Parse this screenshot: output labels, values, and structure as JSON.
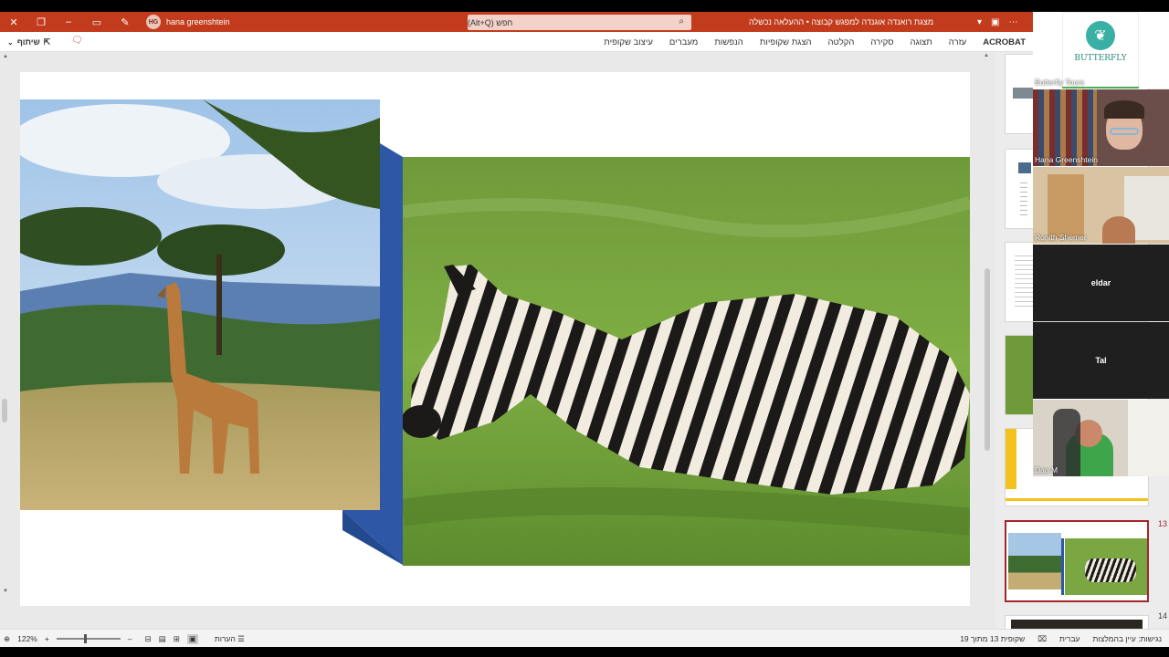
{
  "titlebar": {
    "user_name": "hana greenshtein",
    "user_initials": "HG",
    "search_placeholder": "חפש (Alt+Q)",
    "doc_title": "מצגת רואנדה אוגנדה למפגש קבוצה • ההעלאה נכשלה"
  },
  "ribbon": {
    "tabs": [
      "עיצוב שקופית",
      "מעברים",
      "הנפשות",
      "הצגת שקופיות",
      "הקלטה",
      "סקירה",
      "תצוגה",
      "עזרה",
      "ACROBAT"
    ],
    "share_label": "שיתוף"
  },
  "thumbnails": {
    "current_number": "13",
    "next_number": "14"
  },
  "participants": [
    {
      "name": "Butterfly Tours",
      "kind": "logo",
      "logo_text": "BUTTERFLY"
    },
    {
      "name": "Hana Greenshtein",
      "kind": "video"
    },
    {
      "name": "Ronith Shemer",
      "kind": "video"
    },
    {
      "name": "eldar",
      "kind": "name-only"
    },
    {
      "name": "Tal",
      "kind": "name-only"
    },
    {
      "name": "Dan M",
      "kind": "video"
    }
  ],
  "status": {
    "slide_counter": "שקופית 13 מתוך 19",
    "accessibility": "נגישות: עיין בהמלצות",
    "language": "עברית",
    "notes_label": "הערות",
    "zoom": "122%"
  },
  "colors": {
    "titlebar": "#c23b1c",
    "accent_blue": "#2e58a6",
    "selected_thumb": "#a4262c"
  }
}
